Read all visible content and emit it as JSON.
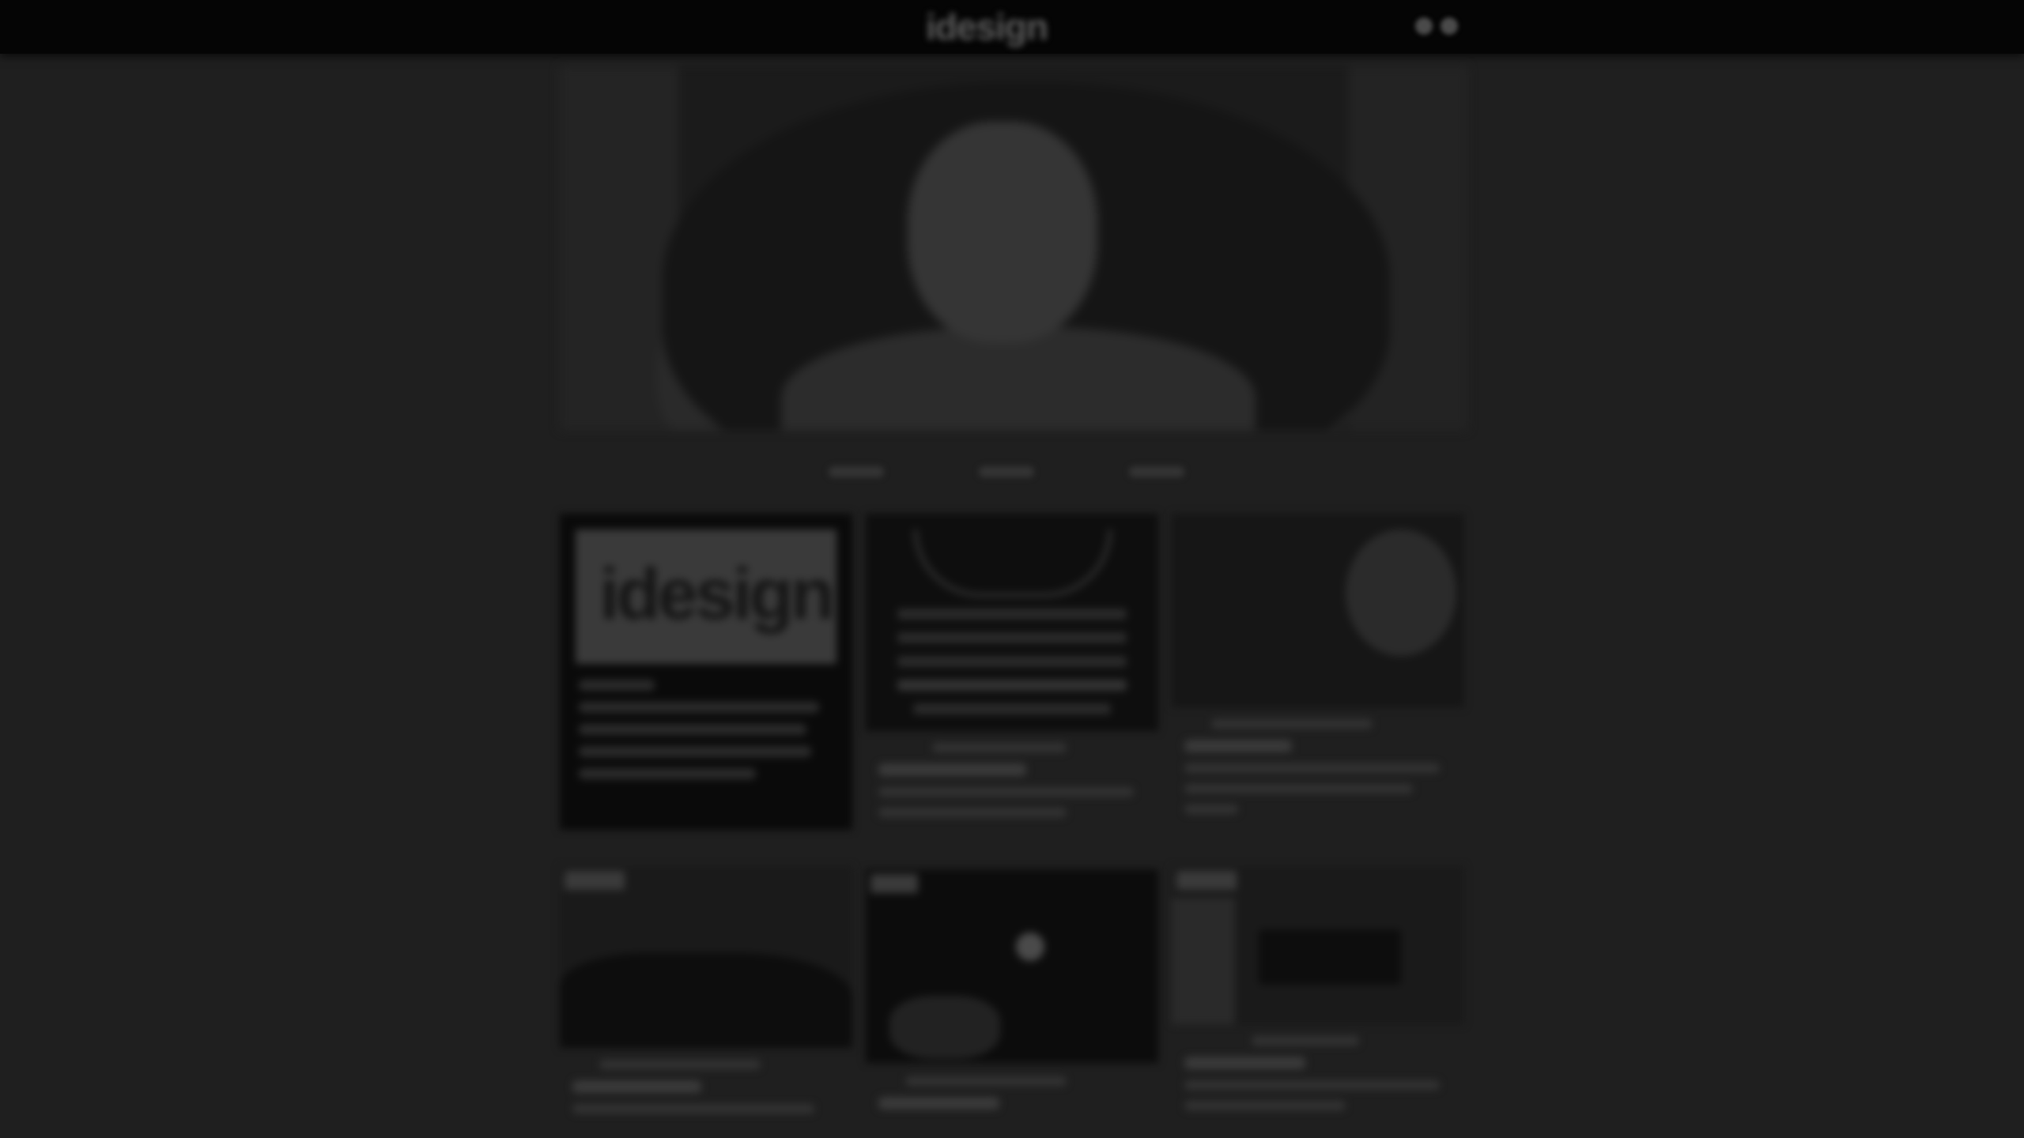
{
  "header": {
    "logo_text": "idesign",
    "icons": [
      "user-icon",
      "menu-icon"
    ]
  },
  "hero": {
    "image": "hero-portrait-image",
    "slides": [
      "slide-1",
      "slide-2",
      "slide-3"
    ]
  },
  "cards": [
    {
      "id": "card-1",
      "cover_word": "idesign"
    },
    {
      "id": "card-2"
    },
    {
      "id": "card-3"
    },
    {
      "id": "card-4"
    },
    {
      "id": "card-5"
    },
    {
      "id": "card-6"
    }
  ],
  "colors": {
    "page_background": "#1f1f1f",
    "topbar_background": "#050505"
  }
}
